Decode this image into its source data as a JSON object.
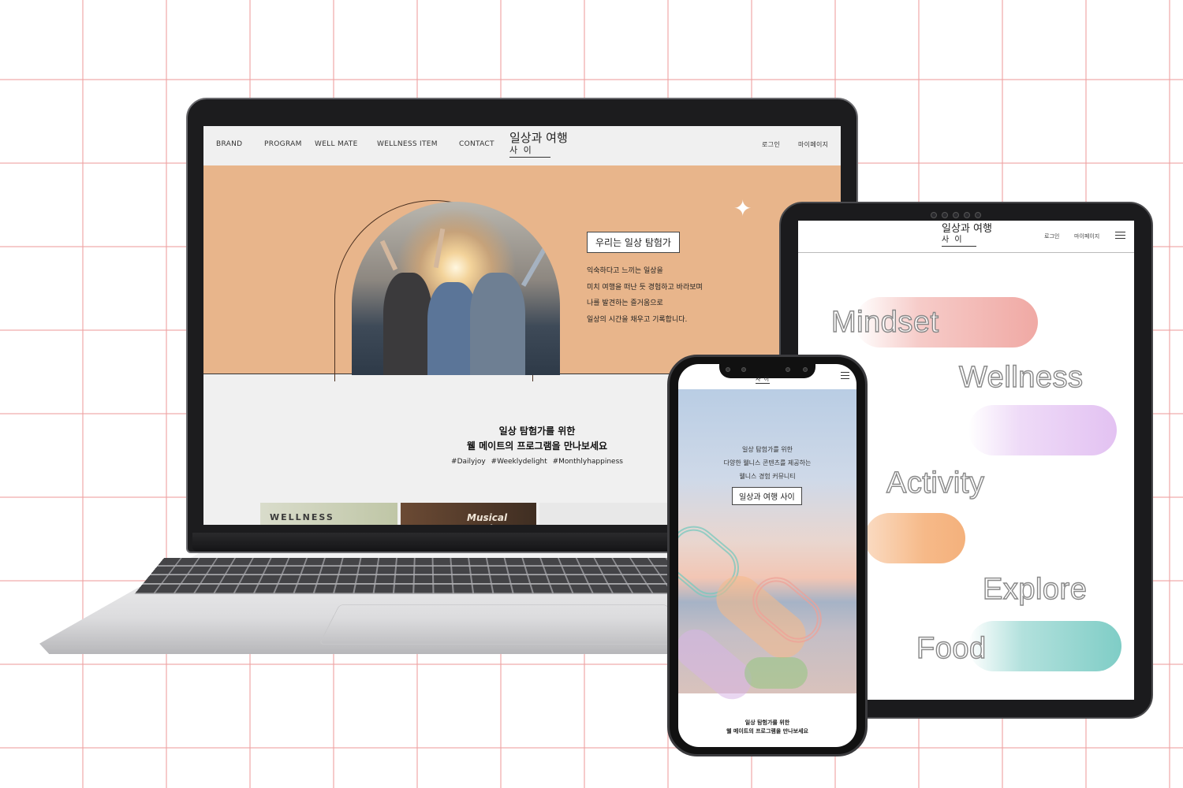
{
  "laptop": {
    "nav": {
      "items": [
        "BRAND",
        "PROGRAM",
        "WELL MATE",
        "WELLNESS ITEM",
        "CONTACT"
      ],
      "logo_main": "일상과 여행",
      "logo_sub": "사    이",
      "login": "로그인",
      "mypage": "마이페이지"
    },
    "hero": {
      "button": "우리는 일상 탐험가",
      "lines": [
        "익숙하다고 느끼는 일상을",
        "미치 여행을 떠난 듯 경험하고 바라보며",
        "나를 발견하는 즐거움으로",
        "일상의 시간을 채우고 기록합니다."
      ]
    },
    "section": {
      "title_line1": "일상 탐험가를 위한",
      "title_line2": "웰 메이트의 프로그램을 만나보세요",
      "tags": "#Dailyjoy #Weeklydelight #Monthlyhappiness"
    },
    "cards": [
      "WELLNESS",
      "Musical Movie",
      ""
    ]
  },
  "tablet": {
    "nav": {
      "logo_main": "일상과 여행",
      "logo_sub": "사    이",
      "login": "로그인",
      "mypage": "마이페이지"
    },
    "categories": [
      {
        "label": "Mindset",
        "color": "#f0a9a4"
      },
      {
        "label": "Wellness",
        "color": "#e3c2f2"
      },
      {
        "label": "Activity",
        "color": "#f6b988"
      },
      {
        "label": "Explore",
        "color": "#ffffff"
      },
      {
        "label": "Food",
        "color": "#7fcdc6"
      }
    ]
  },
  "phone": {
    "logo_sub": "사    이",
    "hero_lines": [
      "일상 탐험가를 위한",
      "다양한 웰니스 콘텐츠를 제공하는",
      "웰니스 경험 커뮤니티"
    ],
    "hero_button": "일상과 여행 사이",
    "bottom_line1": "일상 탐험가를 위한",
    "bottom_line2": "웰 메이트의 프로그램을 만나보세요"
  },
  "colors": {
    "hero_bg": "#e8b58b",
    "grid": "#eea0a0"
  }
}
